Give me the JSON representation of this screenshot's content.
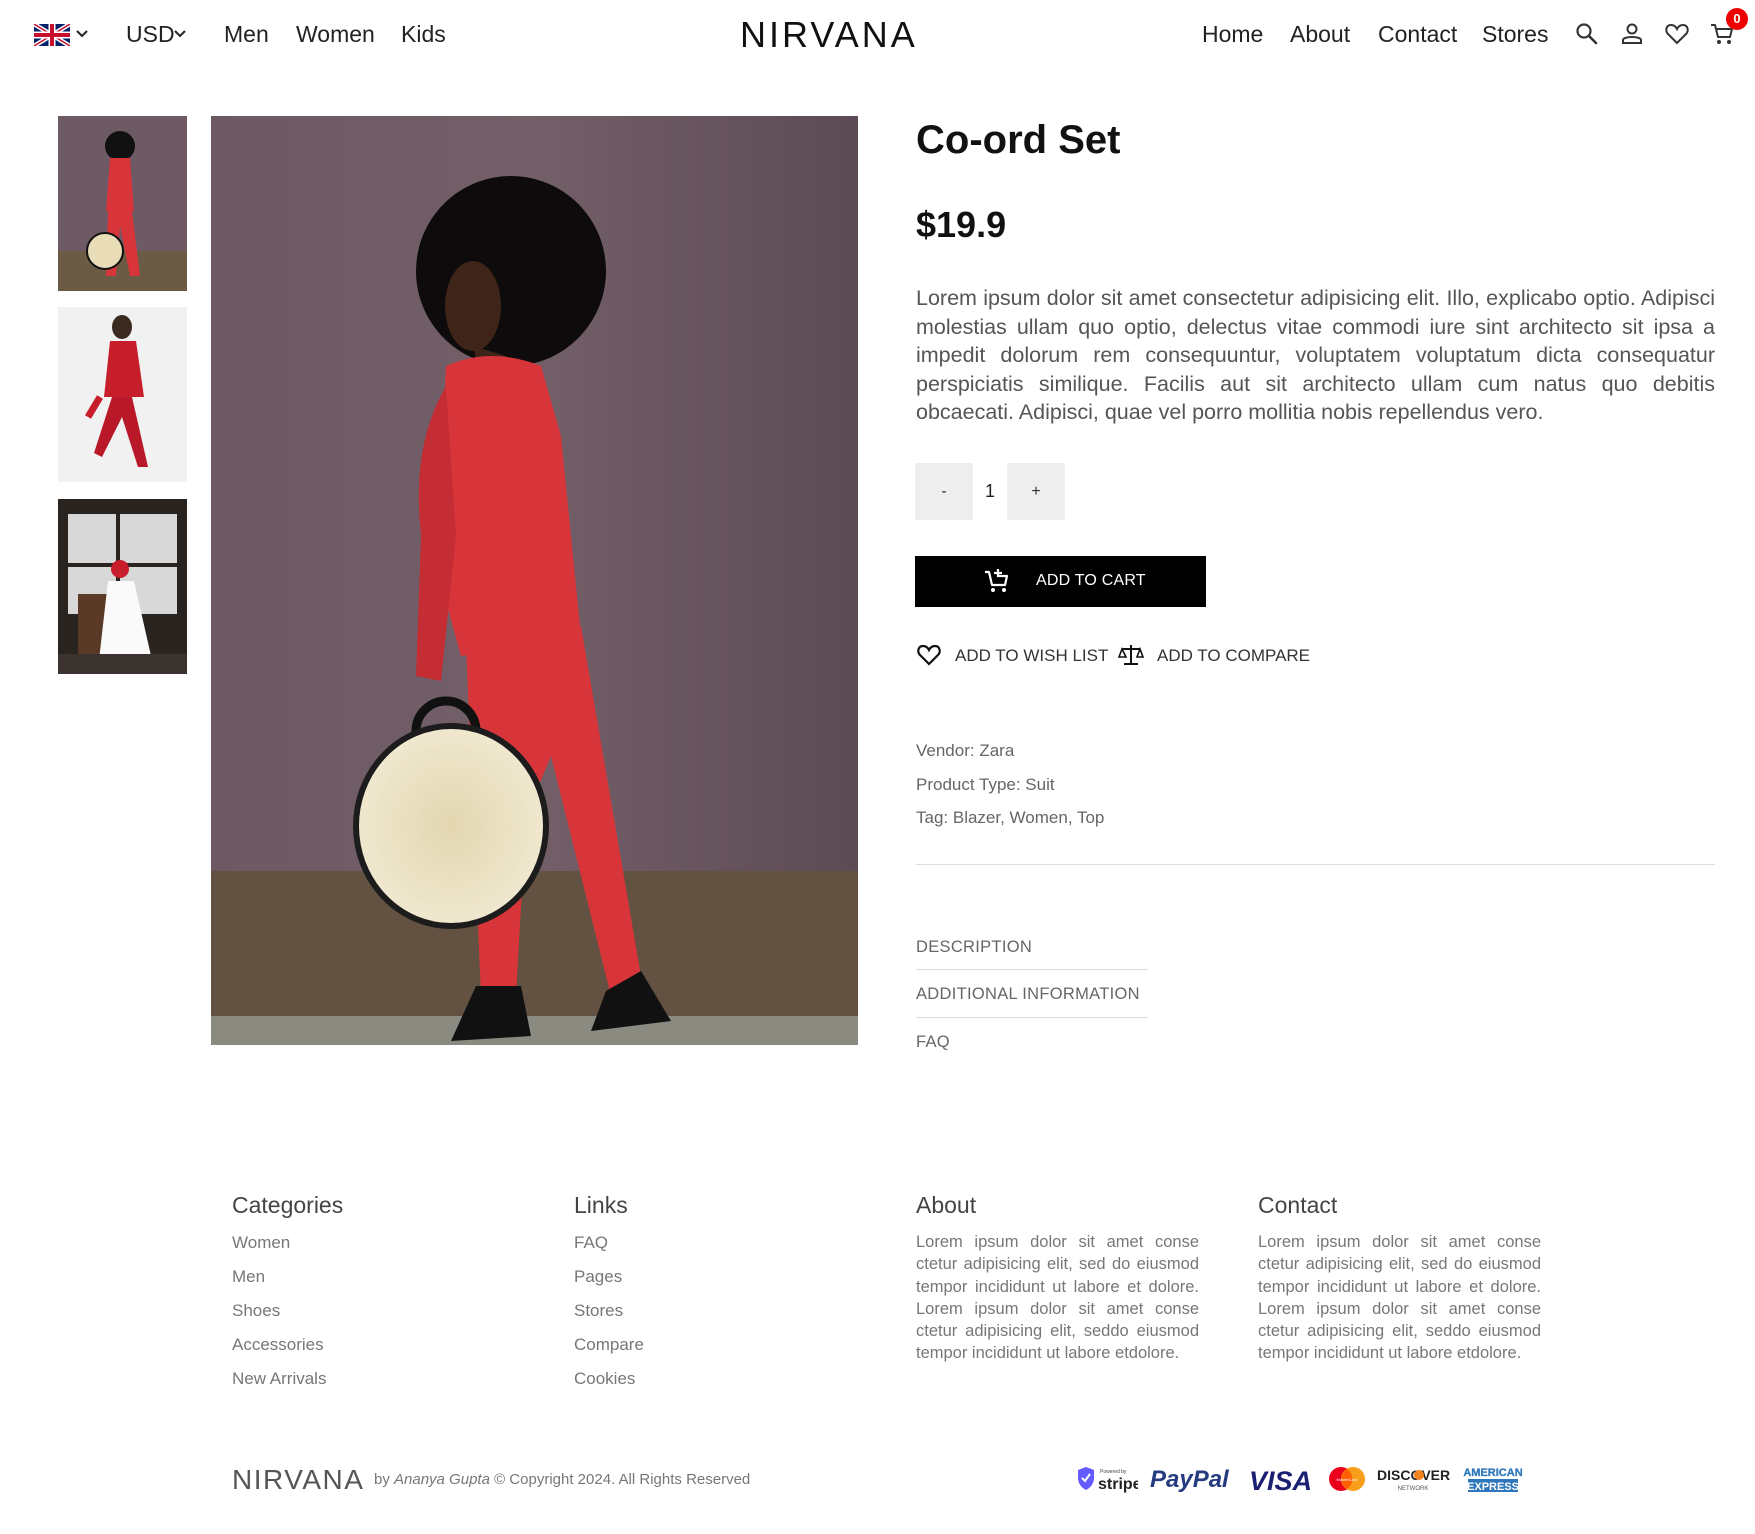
{
  "header": {
    "flag_icon": "uk-flag-icon",
    "currency": "USD",
    "categories": [
      "Men",
      "Women",
      "Kids"
    ],
    "logo": "NIRVANA",
    "nav": [
      "Home",
      "About",
      "Contact",
      "Stores"
    ],
    "icons": [
      "search-icon",
      "user-icon",
      "heart-icon",
      "cart-icon"
    ],
    "cart_count": "0"
  },
  "product": {
    "title": "Co-ord Set",
    "price": "$19.9",
    "description": "Lorem ipsum dolor sit amet consectetur adipisicing elit. Illo, explicabo optio. Adipisci molestias ullam quo optio, delectus vitae commodi iure sint architecto sit ipsa a impedit dolorum rem consequuntur, voluptatem voluptatum dicta consequatur perspiciatis similique. Facilis aut sit architecto ullam cum natus quo debitis obcaecati. Adipisci, quae vel porro mollitia nobis repellendus vero.",
    "qty_minus": "-",
    "quantity": "1",
    "qty_plus": "+",
    "add_to_cart": "ADD TO CART",
    "add_to_wishlist": "ADD TO WISH LIST",
    "add_to_compare": "ADD TO COMPARE",
    "vendor": "Vendor: Zara",
    "product_type": "Product Type: Suit",
    "tags": "Tag: Blazer, Women, Top",
    "tabs": [
      "DESCRIPTION",
      "ADDITIONAL INFORMATION",
      "FAQ"
    ]
  },
  "colors": {
    "accent": "#000000",
    "badge": "#e00000",
    "suit_red": "#d8353a",
    "wall": "#6e5a64"
  },
  "footer": {
    "categories_title": "Categories",
    "categories": [
      "Women",
      "Men",
      "Shoes",
      "Accessories",
      "New Arrivals"
    ],
    "links_title": "Links",
    "links": [
      "FAQ",
      "Pages",
      "Stores",
      "Compare",
      "Cookies"
    ],
    "about_title": "About",
    "about_text": "Lorem ipsum dolor sit amet conse ctetur adipisicing elit, sed do eiusmod tempor incididunt ut labore et dolore. Lorem ipsum dolor sit amet conse ctetur adipisicing elit, seddo eiusmod tempor incididunt ut labore etdolore.",
    "contact_title": "Contact",
    "contact_text": "Lorem ipsum dolor sit amet conse ctetur adipisicing elit, sed do eiusmod tempor incididunt ut labore et dolore. Lorem ipsum dolor sit amet conse ctetur adipisicing elit, seddo eiusmod tempor incididunt ut labore etdolore.",
    "logo": "NIRVANA",
    "copy_prefix": "by ",
    "author": "Ananya Gupta",
    "copy_suffix": " © Copyright 2024. All Rights Reserved",
    "payments": {
      "stripe_small": "Powered by",
      "stripe": "stripe",
      "paypal": "PayPal",
      "visa": "VISA",
      "mastercard": "MasterCard",
      "discover": "DISCOVER",
      "discover_sub": "NETWORK",
      "amex_1": "AMERICAN",
      "amex_2": "EXPRESS"
    }
  }
}
